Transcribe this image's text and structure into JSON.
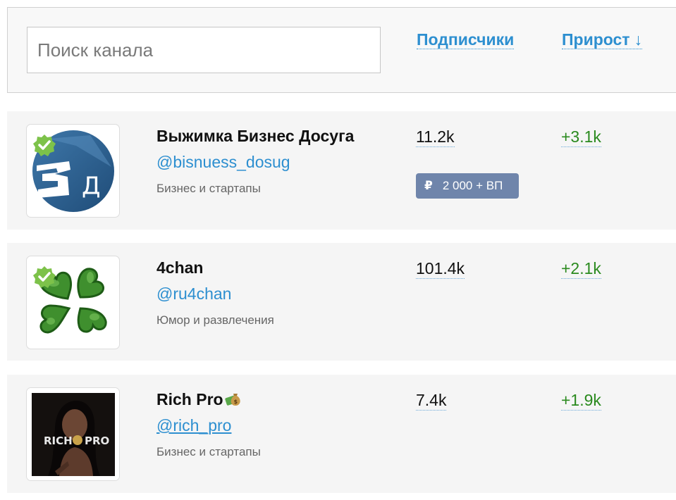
{
  "search": {
    "placeholder": "Поиск канала"
  },
  "sort": {
    "subscribers_label": "Подписчики",
    "growth_label": "Прирост",
    "growth_arrow": "↓"
  },
  "channels": [
    {
      "name": "Выжимка Бизнес Досуга",
      "handle": "@bisnuess_dosug",
      "category": "Бизнес и стартапы",
      "subscribers": "11.2k",
      "growth": "+3.1k",
      "price": {
        "currency_symbol": "₽",
        "label": "2 000 + ВП"
      },
      "verified": true,
      "avatar_icon": "vd-logo-icon",
      "avatar_letters": "Д"
    },
    {
      "name": "4chan",
      "handle": "@ru4chan",
      "category": "Юмор и развлечения",
      "subscribers": "101.4k",
      "growth": "+2.1k",
      "verified": true,
      "avatar_icon": "clover-logo-icon"
    },
    {
      "name": "Rich Pro",
      "name_emoji_icon": "money-bag-icon",
      "handle": "@rich_pro",
      "category": "Бизнес и стартапы",
      "subscribers": "7.4k",
      "growth": "+1.9k",
      "verified": false,
      "avatar_icon": "rich-pro-photo-icon",
      "avatar_text_left": "RICH",
      "avatar_text_right": "PRO"
    }
  ],
  "colors": {
    "link_blue": "#2d8fd0",
    "growth_green": "#2a8a1e",
    "badge_bg": "#6f85ab",
    "card_bg": "#f5f5f5",
    "verified_green": "#7dc24a"
  }
}
